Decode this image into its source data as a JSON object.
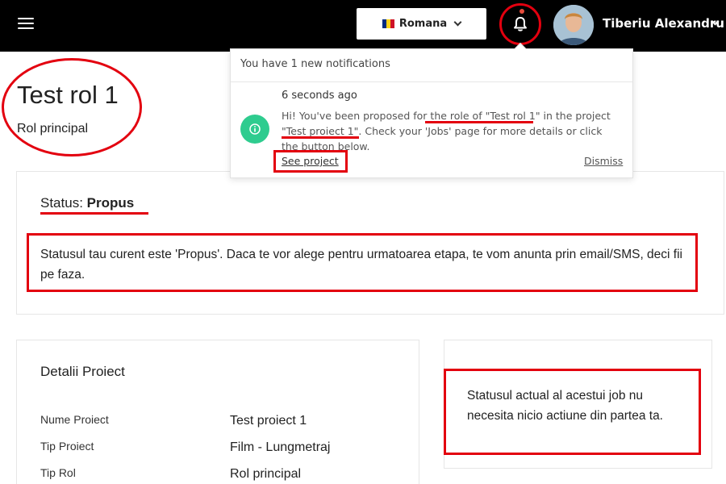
{
  "header": {
    "menu_icon": "hamburger-menu-icon",
    "language": {
      "label": "Romana",
      "flag_colors": [
        "#002B7F",
        "#FCD116",
        "#CE1126"
      ],
      "icon": "chevron-down-icon"
    },
    "notifications": {
      "icon": "bell-icon",
      "has_unread": true
    },
    "user": {
      "name": "Tiberiu Alexandru",
      "icon": "chevron-down-icon"
    }
  },
  "page": {
    "title": "Test rol 1",
    "subtitle": "Rol principal"
  },
  "status": {
    "label": "Status:",
    "value": "Propus",
    "description": "Statusul tau curent este 'Propus'. Daca te vor alege pentru urmatoarea etapa, te vom anunta prin email/SMS, deci fii pe faza."
  },
  "project_details": {
    "title": "Detalii Proiect",
    "rows": [
      {
        "label": "Nume Proiect",
        "value": "Test proiect 1"
      },
      {
        "label": "Tip Proiect",
        "value": "Film - Lungmetraj"
      },
      {
        "label": "Tip Rol",
        "value": "Rol principal"
      }
    ]
  },
  "info": {
    "text": "Statusul actual al acestui job nu necesita nicio actiune din partea ta."
  },
  "notification_panel": {
    "header": "You have 1 new notifications",
    "items": [
      {
        "time": "6 seconds ago",
        "icon": "info-icon",
        "message": "Hi! You've been proposed for the role of \"Test rol 1\" in the project \"Test proiect 1\". Check your 'Jobs' page for more details or click the button below.",
        "action_label": "See project",
        "dismiss_label": "Dismiss"
      }
    ]
  },
  "colors": {
    "topbar": "#000000",
    "highlight": "#e3000f",
    "notif_icon": "#2ecc8f"
  }
}
